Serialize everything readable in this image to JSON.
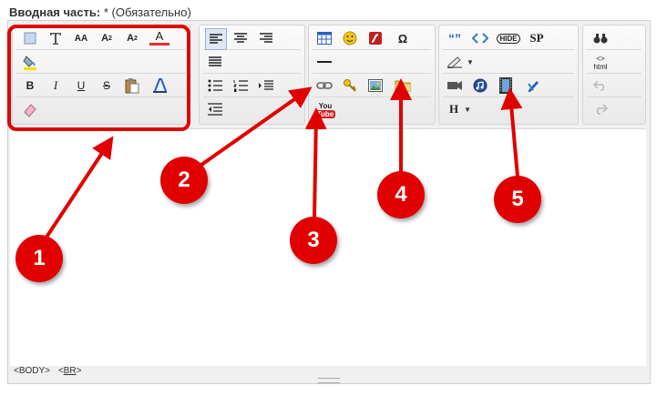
{
  "form": {
    "label": "Вводная часть:",
    "required_mark": "*",
    "required_note": "(Обязательно)"
  },
  "toolbar": {
    "font_size_aa": "AA",
    "subscript": "A",
    "subscript_sub": "2",
    "superscript": "A",
    "superscript_sup": "2",
    "font_color": "A",
    "bold": "B",
    "italic": "I",
    "underline": "U",
    "strike": "S",
    "omega": "Ω",
    "quote": "“”",
    "hide": "HIDE",
    "sp": "SP",
    "html": "html",
    "html_code": "<>",
    "heading": "H",
    "youtube_you": "You",
    "youtube_tube": "Tube"
  },
  "status": {
    "body_tag": "<BODY>",
    "br_tag": "BR"
  },
  "callouts": [
    "1",
    "2",
    "3",
    "4",
    "5"
  ],
  "colors": {
    "highlight": "#e00000",
    "editor_bg": "#f0f0f0"
  }
}
